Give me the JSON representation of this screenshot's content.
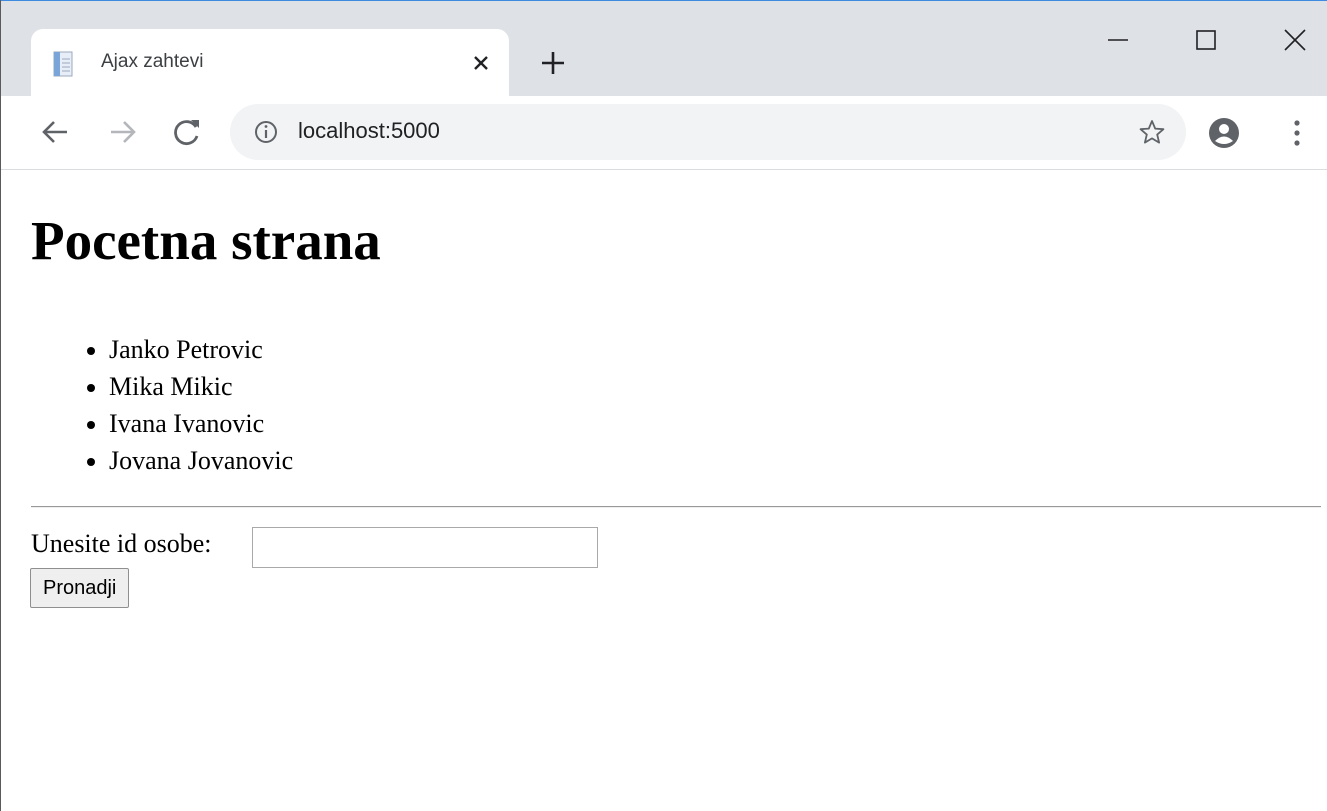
{
  "browser": {
    "tab": {
      "title": "Ajax zahtevi",
      "favicon": "document-icon"
    },
    "address_bar": {
      "url": "localhost:5000"
    },
    "icons": {
      "tab_close": "close-icon",
      "new_tab": "plus-icon",
      "minimize": "minimize-icon",
      "maximize": "maximize-icon",
      "window_close": "close-icon",
      "back": "arrow-left-icon",
      "forward": "arrow-right-icon",
      "reload": "reload-icon",
      "site_info": "info-icon",
      "bookmark": "star-icon",
      "profile": "account-icon",
      "menu": "kebab-menu-icon"
    }
  },
  "page": {
    "title": "Pocetna strana",
    "people": [
      "Janko Petrovic",
      "Mika Mikic",
      "Ivana Ivanovic",
      "Jovana Jovanovic"
    ],
    "form": {
      "label": "Unesite id osobe:",
      "input_value": "",
      "button_label": "Pronadji"
    }
  },
  "colors": {
    "tabstrip_bg": "#dee1e6",
    "omnibox_bg": "#f1f3f4",
    "text": "#000000"
  }
}
